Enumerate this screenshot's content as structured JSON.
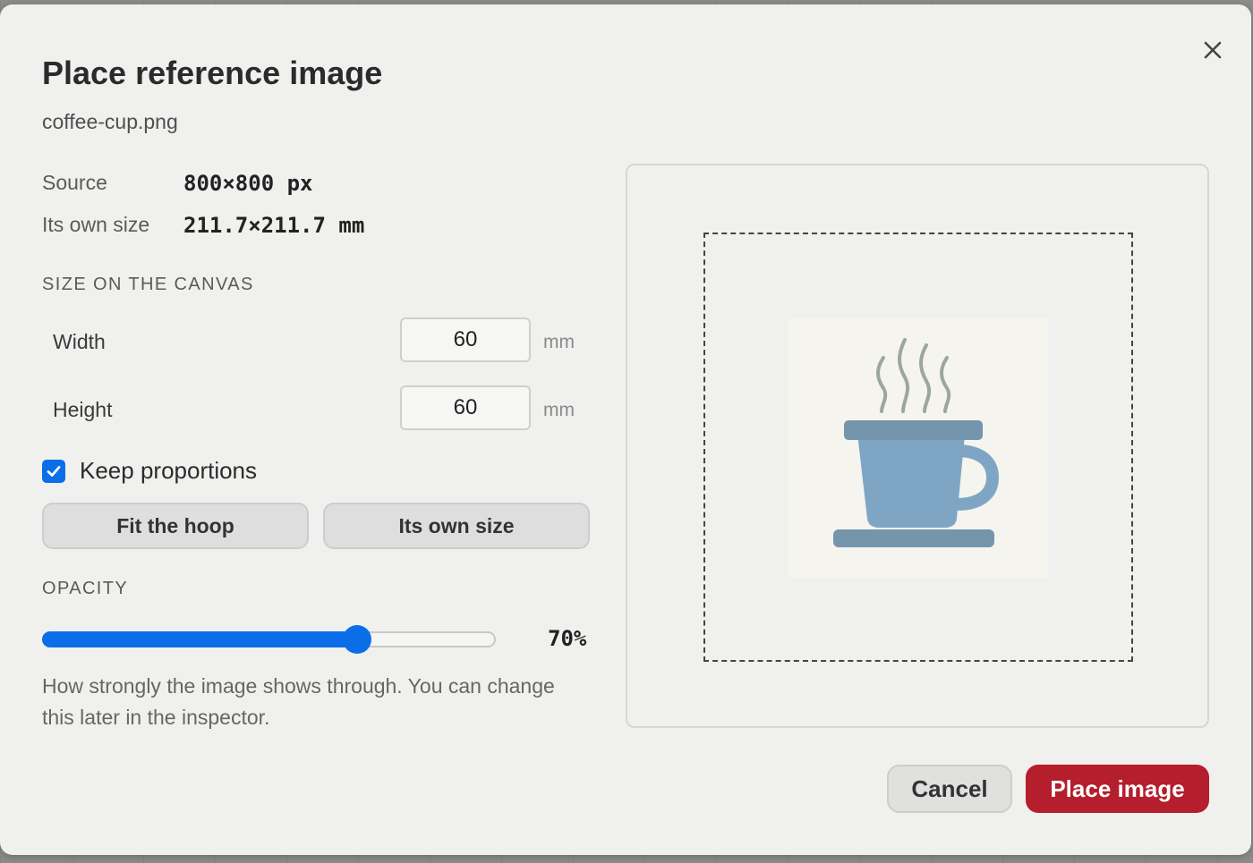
{
  "dialog": {
    "title": "Place reference image",
    "filename": "coffee-cup.png",
    "close_icon": "close-icon"
  },
  "info": {
    "source_label": "Source",
    "source_value": "800×800 px",
    "own_size_label": "Its own size",
    "own_size_value": "211.7×211.7 mm"
  },
  "size": {
    "section_label": "SIZE ON THE CANVAS",
    "width_label": "Width",
    "width_value": "60",
    "width_unit": "mm",
    "height_label": "Height",
    "height_value": "60",
    "height_unit": "mm",
    "keep_proportions_label": "Keep proportions",
    "keep_proportions_checked": true,
    "fit_hoop_label": "Fit the hoop",
    "own_size_button_label": "Its own size"
  },
  "opacity": {
    "section_label": "OPACITY",
    "value_percent": 70,
    "value_text": "70%",
    "help_text": "How strongly the image shows through. You can change this later in the inspector."
  },
  "preview": {
    "image_icon": "coffee-cup-icon"
  },
  "footer": {
    "cancel_label": "Cancel",
    "place_label": "Place image"
  },
  "colors": {
    "accent": "#0a6ee8",
    "primary_button": "#b51e2c",
    "cup": "#7ea6c4",
    "cup_dark": "#7595ad",
    "steam": "#9aa89c"
  }
}
